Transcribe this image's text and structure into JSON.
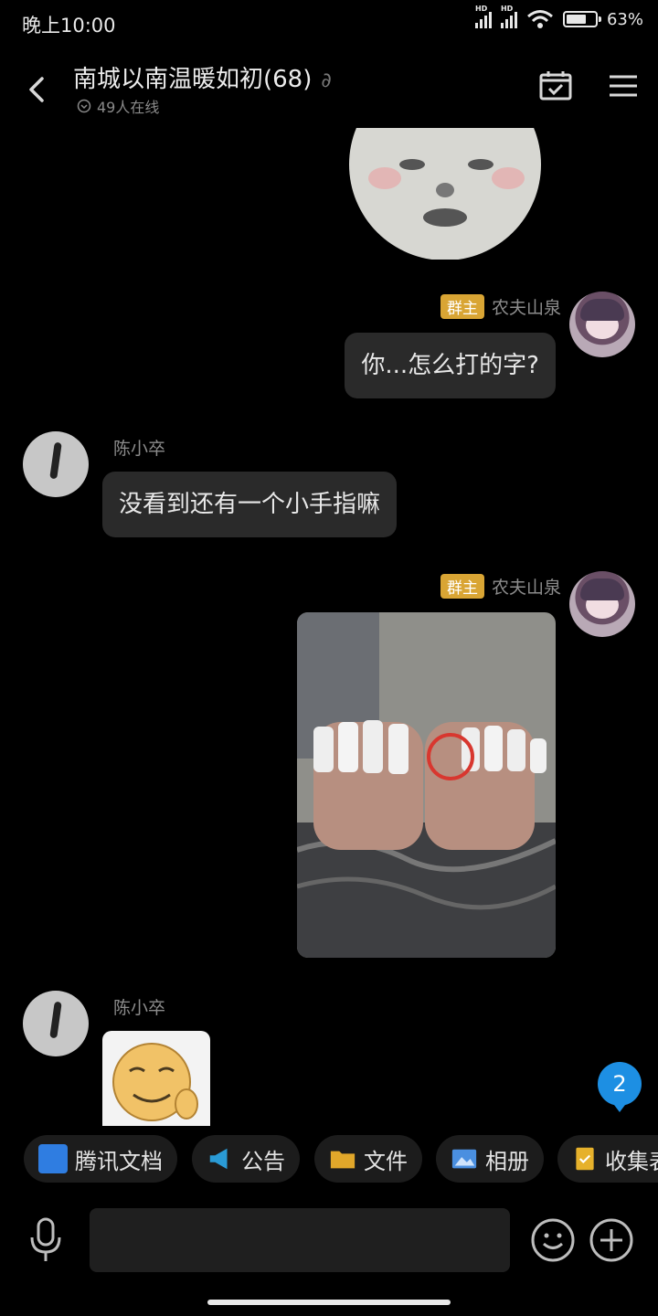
{
  "status_bar": {
    "time": "晚上10:00",
    "battery": "63%",
    "signal_label": "HD"
  },
  "header": {
    "title": "南城以南温暖如初(68)",
    "online": "49人在线"
  },
  "messages": [
    {
      "sender": "农夫山泉",
      "role_badge": "群主",
      "text": "你...怎么打的字?"
    },
    {
      "sender": "陈小卒",
      "text": "没看到还有一个小手指嘛"
    },
    {
      "sender": "农夫山泉",
      "role_badge": "群主"
    },
    {
      "sender": "陈小卒"
    }
  ],
  "unread_count": "2",
  "toolbar": {
    "items": [
      {
        "label": "腾讯文档",
        "icon": "tencent-docs-icon",
        "color": "#2f7de1"
      },
      {
        "label": "公告",
        "icon": "megaphone-icon",
        "color": "#2a9bd6"
      },
      {
        "label": "文件",
        "icon": "folder-icon",
        "color": "#e1a72a"
      },
      {
        "label": "相册",
        "icon": "album-icon",
        "color": "#4a8fe0"
      },
      {
        "label": "收集表",
        "icon": "form-icon",
        "color": "#e6b12b"
      }
    ]
  }
}
